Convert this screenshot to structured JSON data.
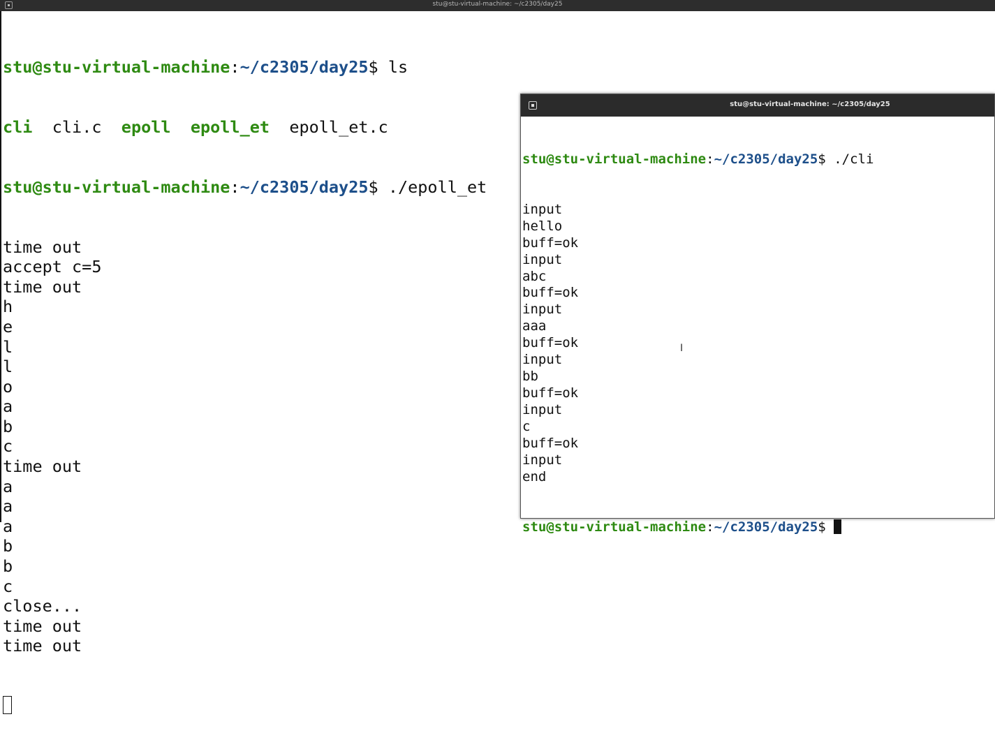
{
  "top_window": {
    "title": "stu@stu-virtual-machine: ~/c2305/day25",
    "prompt": {
      "user": "stu@stu-virtual-machine",
      "path": "~/c2305/day25",
      "symbol": "$"
    },
    "cmd1": "ls",
    "ls": {
      "cli": "cli",
      "cli_c": "cli.c",
      "epoll": "epoll",
      "epoll_et": "epoll_et",
      "epoll_et_c": "epoll_et.c"
    },
    "cmd2": "./epoll_et",
    "output": [
      "time out",
      "accept c=5",
      "time out",
      "h",
      "e",
      "l",
      "l",
      "o",
      "a",
      "b",
      "c",
      "time out",
      "a",
      "a",
      "a",
      "b",
      "b",
      "c",
      "close...",
      "time out",
      "time out"
    ]
  },
  "client_window": {
    "title": "stu@stu-virtual-machine: ~/c2305/day25",
    "prompt": {
      "user": "stu@stu-virtual-machine",
      "path": "~/c2305/day25",
      "symbol": "$"
    },
    "cmd": "./cli",
    "output": [
      "input",
      "hello",
      "buff=ok",
      "input",
      "abc",
      "buff=ok",
      "input",
      "aaa",
      "buff=ok",
      "input",
      "bb",
      "buff=ok",
      "input",
      "c",
      "buff=ok",
      "input",
      "end"
    ]
  }
}
